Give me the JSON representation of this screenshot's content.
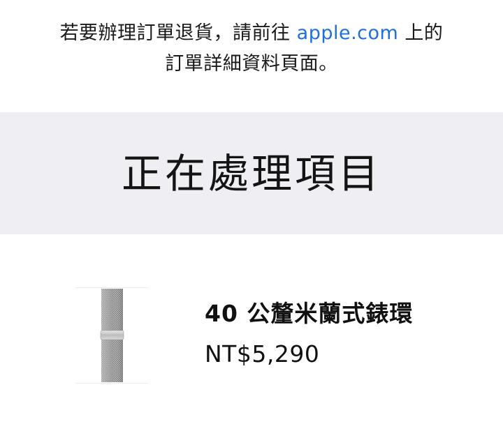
{
  "notice": {
    "text_before": "若要辦理訂單退貨，請前往 ",
    "link_text": "apple.com",
    "text_after": " 上的",
    "line2": "訂單詳細資料頁面。"
  },
  "section": {
    "title": "正在處理項目"
  },
  "item": {
    "name": "40 公釐米蘭式錶環",
    "price": "NT$5,290",
    "image_icon": "milanese-loop-band-icon"
  },
  "colors": {
    "link": "#1e6fe0",
    "band_background": "#efeff3",
    "text": "#111111"
  }
}
